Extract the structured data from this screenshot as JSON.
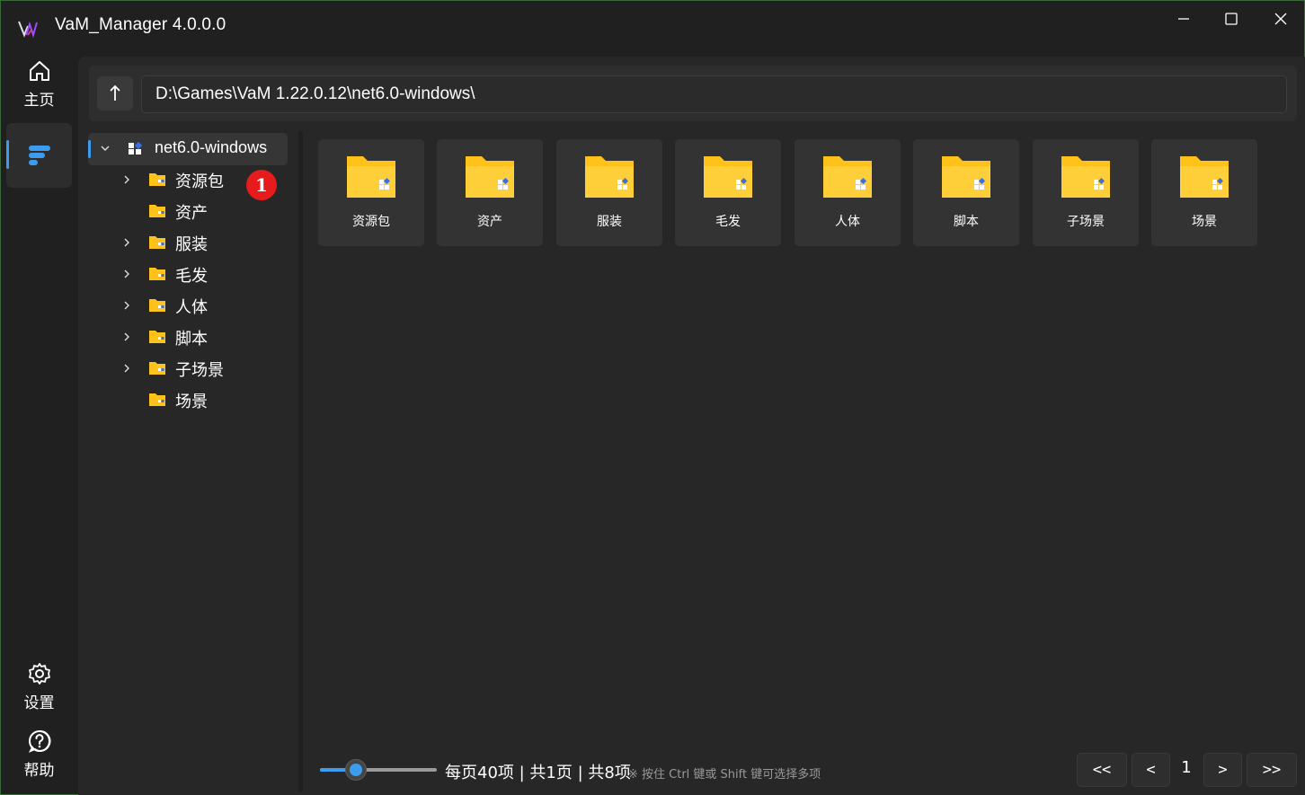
{
  "window": {
    "title": "VaM_Manager  4.0.0.0"
  },
  "nav": {
    "home_label": "主页",
    "settings_label": "设置",
    "help_label": "帮助"
  },
  "pathbar": {
    "path": "D:\\Games\\VaM 1.22.0.12\\net6.0-windows\\"
  },
  "tree": {
    "root_label": "net6.0-windows",
    "items": [
      {
        "label": "资源包",
        "expandable": true
      },
      {
        "label": "资产",
        "expandable": false
      },
      {
        "label": "服装",
        "expandable": true
      },
      {
        "label": "毛发",
        "expandable": true
      },
      {
        "label": "人体",
        "expandable": true
      },
      {
        "label": "脚本",
        "expandable": true
      },
      {
        "label": "子场景",
        "expandable": true
      },
      {
        "label": "场景",
        "expandable": false
      }
    ]
  },
  "annotation_badge": "1",
  "folders": [
    "资源包",
    "资产",
    "服装",
    "毛发",
    "人体",
    "脚本",
    "子场景",
    "场景"
  ],
  "footer": {
    "page_info": "每页40项 | 共1页 | 共8项",
    "hint": "※ 按住 Ctrl 键或 Shift 键可选择多项",
    "first": "<<",
    "prev": "<",
    "page": "1",
    "next": ">",
    "last": ">>"
  },
  "colors": {
    "accent": "#3b9cf0",
    "folder": "#ffc21a",
    "background": "#202020",
    "panel": "#272727",
    "card": "#333333"
  }
}
